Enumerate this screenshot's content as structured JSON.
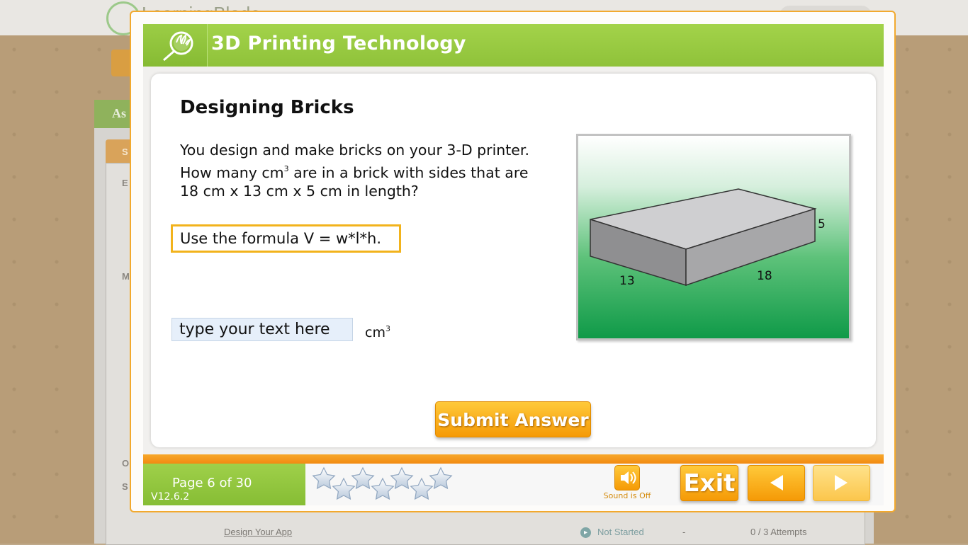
{
  "background": {
    "logo_text": "LearningBlade",
    "section_letters": [
      "As",
      "S",
      "E",
      "M",
      "O",
      "S"
    ],
    "last_row": {
      "link": "Design Your App",
      "status": "Not Started",
      "dash": "-",
      "attempts": "0 / 3 Attempts"
    }
  },
  "header": {
    "title": "3D Printing Technology",
    "logo_icon": "magnifier-leaf-icon"
  },
  "question": {
    "title": "Designing Bricks",
    "line1": "You design and make bricks on your 3-D printer.",
    "line2_pre": "How many cm",
    "line2_sup": "3",
    "line2_post": " are in a brick with sides that are",
    "line3": "18 cm x 13 cm x 5 cm in length?",
    "hint": "Use the formula V = w*l*h.",
    "answer_placeholder": "type your text here",
    "answer_value": "",
    "unit": "cm",
    "unit_sup": "3",
    "figure_labels": {
      "height": "5",
      "width": "13",
      "length": "18"
    },
    "submit_label": "Submit Answer"
  },
  "footer": {
    "page": "Page 6 of 30",
    "version": "V12.6.2",
    "stars_count": 7,
    "sound_label": "Sound is Off",
    "exit_label": "Exit",
    "prev_icon": "left-arrow-icon",
    "next_icon": "right-arrow-icon"
  },
  "colors": {
    "accent_green": "#8fc23a",
    "accent_orange": "#f59a06",
    "input_bg": "#e6effa"
  }
}
